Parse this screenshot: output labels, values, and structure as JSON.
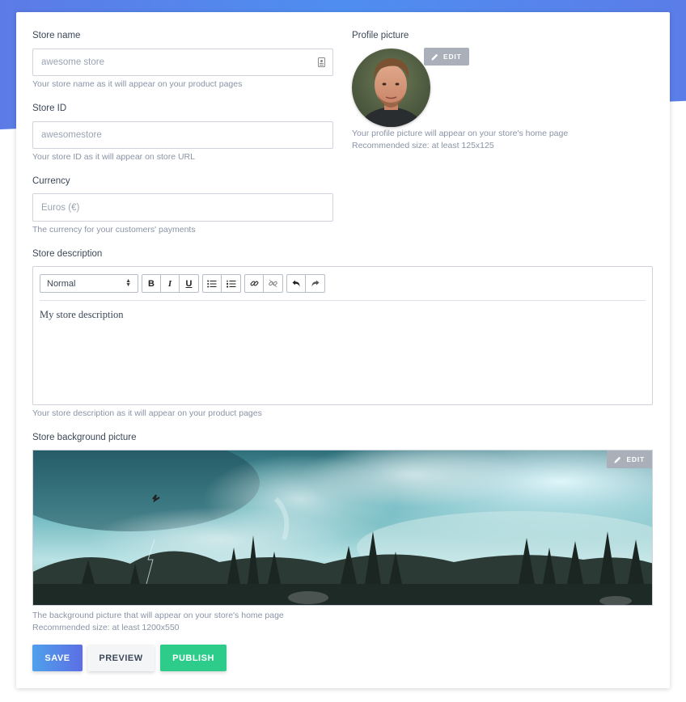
{
  "store_name": {
    "label": "Store name",
    "placeholder": "awesome store",
    "help": "Your store name as it will appear on your product pages"
  },
  "store_id": {
    "label": "Store ID",
    "placeholder": "awesomestore",
    "help": "Your store ID as it will appear on store URL"
  },
  "currency": {
    "label": "Currency",
    "placeholder": "Euros (€)",
    "help": "The currency for your customers' payments"
  },
  "profile_picture": {
    "label": "Profile picture",
    "edit_label": "EDIT",
    "help_line1": "Your profile picture will appear on your store's home page",
    "help_line2": "Recommended size: at least 125x125"
  },
  "store_description": {
    "label": "Store description",
    "format_select": "Normal",
    "content": "My store description",
    "help": "Your store description as it will appear on your product pages"
  },
  "background_picture": {
    "label": "Store background picture",
    "edit_label": "EDIT",
    "help_line1": "The background picture that will appear on your store's home page",
    "help_line2": "Recommended size: at least 1200x550"
  },
  "actions": {
    "save": "SAVE",
    "preview": "PREVIEW",
    "publish": "PUBLISH"
  },
  "colors": {
    "accent_blue": "#5b7de8",
    "publish_green": "#2ecc8a",
    "edit_gray": "#a9b0ba"
  },
  "icons": {
    "store_name_field": "contact-card-icon",
    "edit": "pencil-icon",
    "bold": "bold-icon",
    "italic": "italic-icon",
    "underline": "underline-icon",
    "bullet_list": "bullet-list-icon",
    "ordered_list": "ordered-list-icon",
    "link": "link-icon",
    "unlink": "unlink-icon",
    "undo": "undo-icon",
    "redo": "redo-icon"
  }
}
